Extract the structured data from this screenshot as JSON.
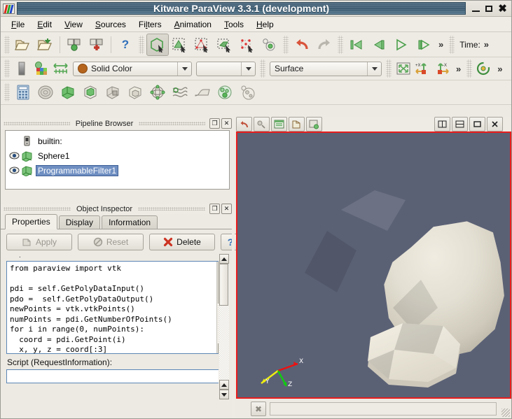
{
  "window": {
    "title": "Kitware ParaView 3.3.1 (development)",
    "logo_name": "paraview-logo-icon",
    "buttons": {
      "minimize": "minimize",
      "maximize": "maximize",
      "close": "close"
    }
  },
  "menubar": {
    "items": [
      {
        "label": "File",
        "accel": "F"
      },
      {
        "label": "Edit",
        "accel": "E"
      },
      {
        "label": "View",
        "accel": "V"
      },
      {
        "label": "Sources",
        "accel": "S"
      },
      {
        "label": "Filters",
        "accel": "l"
      },
      {
        "label": "Animation",
        "accel": "A"
      },
      {
        "label": "Tools",
        "accel": "T"
      },
      {
        "label": "Help",
        "accel": "H"
      }
    ]
  },
  "toolbar_main": {
    "buttons": [
      {
        "name": "open-file-icon",
        "tip": "Open"
      },
      {
        "name": "save-data-icon",
        "tip": "Save Data"
      },
      {
        "name": "connect-server-icon",
        "tip": "Connect"
      },
      {
        "name": "disconnect-server-icon",
        "tip": "Disconnect"
      },
      {
        "name": "help-icon",
        "tip": "Help"
      },
      {
        "name": "select-cells-through-icon",
        "tip": "Frustum Cell Select",
        "active": true
      },
      {
        "name": "select-points-through-icon",
        "tip": "Frustum Point Select"
      },
      {
        "name": "select-points-icon",
        "tip": "Select Points"
      },
      {
        "name": "select-surface-cells-icon",
        "tip": "Select Cells On"
      },
      {
        "name": "select-surface-points-icon",
        "tip": "Select Points On"
      },
      {
        "name": "select-block-icon",
        "tip": "Select Block"
      },
      {
        "name": "undo-icon",
        "tip": "Undo"
      },
      {
        "name": "redo-icon",
        "tip": "Redo"
      },
      {
        "name": "first-frame-icon",
        "tip": "First Frame"
      },
      {
        "name": "previous-frame-icon",
        "tip": "Previous Frame"
      },
      {
        "name": "play-icon",
        "tip": "Play"
      },
      {
        "name": "next-frame-icon",
        "tip": "Next Frame"
      }
    ],
    "overflow_label": "»",
    "time_label": "Time:"
  },
  "toolbar_display": {
    "color_by": {
      "value": "Solid Color",
      "swatch_color": "#b5651d"
    },
    "array_component": {
      "value": ""
    },
    "representation": {
      "value": "Surface"
    },
    "buttons": [
      {
        "name": "scalar-bar-icon"
      },
      {
        "name": "edit-color-map-icon"
      },
      {
        "name": "rescale-range-icon"
      },
      {
        "name": "reset-camera-icon"
      },
      {
        "name": "set-view-plus-x-icon",
        "label": "+X"
      },
      {
        "name": "set-view-minus-x-icon",
        "label": "-X"
      },
      {
        "name": "camera-rotate-icon"
      }
    ],
    "overflow_label": "»"
  },
  "toolbar_filters": {
    "buttons": [
      {
        "name": "calculator-filter-icon"
      },
      {
        "name": "contour-filter-icon"
      },
      {
        "name": "clip-filter-icon"
      },
      {
        "name": "slice-filter-icon"
      },
      {
        "name": "threshold-filter-icon"
      },
      {
        "name": "extract-subset-icon"
      },
      {
        "name": "glyph-filter-icon"
      },
      {
        "name": "stream-tracer-icon"
      },
      {
        "name": "warp-filter-icon"
      },
      {
        "name": "group-datasets-icon"
      },
      {
        "name": "extract-level-icon"
      }
    ]
  },
  "pipeline_browser": {
    "title": "Pipeline Browser",
    "undock_label": "❐",
    "close_label": "✕",
    "items": [
      {
        "label": "builtin:",
        "icon": "server-icon",
        "eye": false,
        "selected": false
      },
      {
        "label": "Sphere1",
        "icon": "source-icon",
        "eye": true,
        "selected": false
      },
      {
        "label": "ProgrammableFilter1",
        "icon": "source-icon",
        "eye": true,
        "selected": true
      }
    ]
  },
  "object_inspector": {
    "title": "Object Inspector",
    "undock_label": "❐",
    "close_label": "✕",
    "tabs": [
      {
        "label": "Properties",
        "active": true
      },
      {
        "label": "Display",
        "active": false
      },
      {
        "label": "Information",
        "active": false
      }
    ],
    "buttons": [
      {
        "label": "Apply",
        "name": "apply-button",
        "icon": "apply-icon",
        "enabled": false
      },
      {
        "label": "Reset",
        "name": "reset-button",
        "icon": "reset-icon",
        "enabled": false
      },
      {
        "label": "Delete",
        "name": "delete-button",
        "icon": "delete-x-icon",
        "enabled": true
      }
    ],
    "help_label": "?",
    "script_editor": {
      "code": "from paraview import vtk\n\npdi = self.GetPolyDataInput()\npdo =  self.GetPolyDataOutput()\nnewPoints = vtk.vtkPoints()\nnumPoints = pdi.GetNumberOfPoints()\nfor i in range(0, numPoints):\n  coord = pdi.GetPoint(i)\n  x, y, z = coord[:3]"
    },
    "request_information_label": "Script (RequestInformation):",
    "request_information_value": ""
  },
  "render_view": {
    "toolbar_buttons": [
      {
        "name": "undo-camera-icon"
      },
      {
        "name": "redo-camera-icon"
      },
      {
        "name": "show-center-axes-icon"
      },
      {
        "name": "pick-center-icon"
      },
      {
        "name": "reset-center-icon"
      }
    ],
    "layout_buttons": [
      {
        "name": "split-horizontal-icon",
        "label": "▥"
      },
      {
        "name": "split-vertical-icon",
        "label": "▤"
      },
      {
        "name": "maximize-view-icon",
        "label": "□"
      },
      {
        "name": "close-view-icon",
        "label": "✕"
      }
    ],
    "background_color": "#5b6175",
    "border_color": "#e81d1d",
    "orientation_axes": {
      "x": "X",
      "y": "Y",
      "z": "Z",
      "x_color": "#ee1111",
      "y_color": "#eeee11",
      "z_color": "#11cc11"
    },
    "objects": [
      {
        "name": "sphere-geometry",
        "surface_color": "#e4e0d4"
      },
      {
        "name": "flattened-geometry",
        "surface_color": "#efebdf"
      }
    ]
  },
  "status_bar": {
    "cancel_label": "✖",
    "message": ""
  }
}
